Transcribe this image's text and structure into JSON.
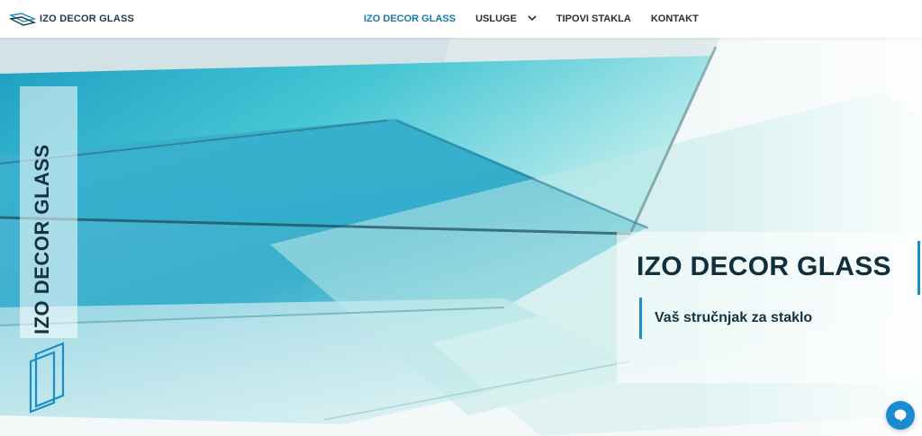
{
  "brand": {
    "logo_text": "IZO DECOR GLASS",
    "accent_color": "#1a78a8"
  },
  "nav": {
    "items": [
      {
        "label": "IZO DECOR GLASS",
        "active": true
      },
      {
        "label": "USLUGE",
        "active": false,
        "has_dropdown": true
      },
      {
        "label": "TIPOVI STAKLA",
        "active": false
      },
      {
        "label": "KONTAKT",
        "active": false
      }
    ]
  },
  "hero": {
    "vertical_title": "IZO DECOR GLASS",
    "title": "IZO DECOR GLASS",
    "subtitle": "Vaš stručnjak za staklo"
  },
  "icons": {
    "logo": "glass-panes-logo-icon",
    "dropdown": "chevron-down-icon",
    "chat": "chat-bubble-icon"
  }
}
